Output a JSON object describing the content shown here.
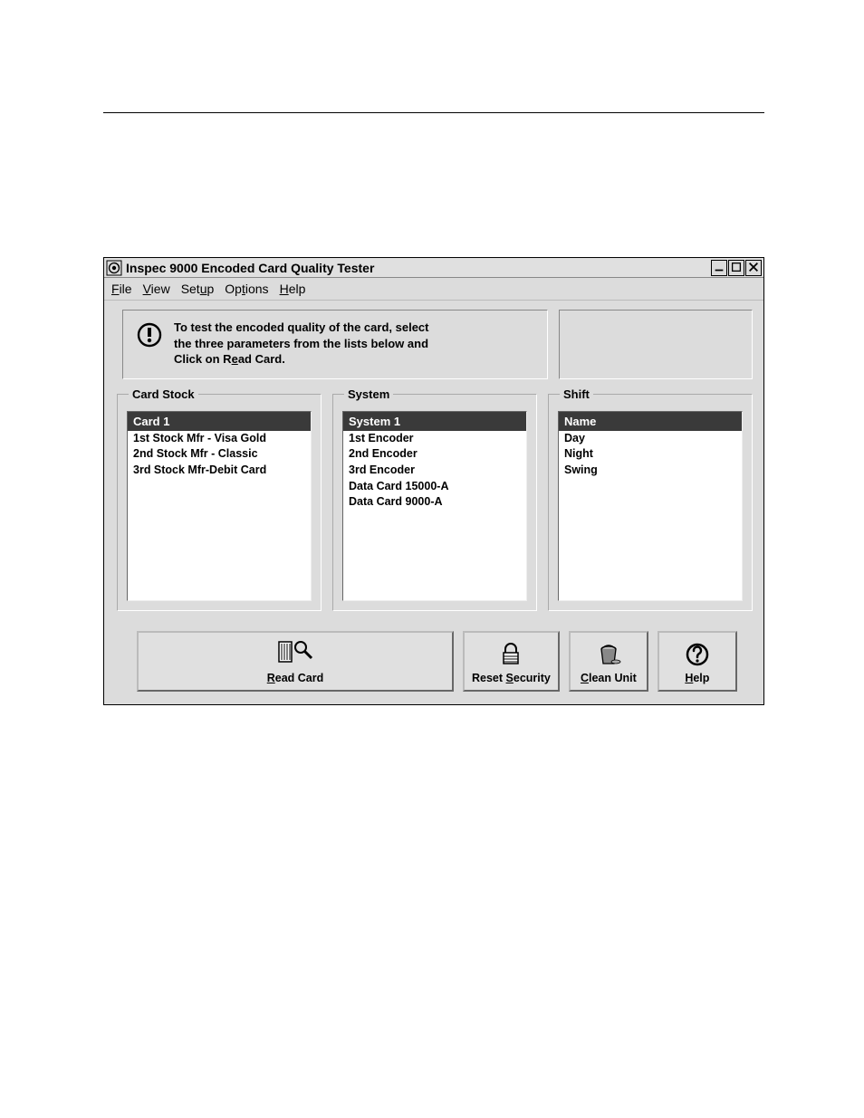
{
  "window": {
    "title": "Inspec 9000 Encoded Card Quality Tester"
  },
  "menu": {
    "file": "File",
    "view": "View",
    "setup": "Setup",
    "options": "Options",
    "help": "Help"
  },
  "info": {
    "line1": "To test the encoded quality of the card, select",
    "line2": "the three parameters from the lists below and",
    "line3_pre": "Click on R",
    "line3_post": "ead Card."
  },
  "groups": {
    "card_stock": {
      "label": "Card Stock",
      "header": "Card 1",
      "items": [
        "1st Stock Mfr - Visa Gold",
        "2nd Stock Mfr - Classic",
        "3rd Stock Mfr-Debit Card"
      ]
    },
    "system": {
      "label": "System",
      "header": "System 1",
      "items": [
        "1st Encoder",
        "2nd Encoder",
        "3rd Encoder",
        "Data Card 15000-A",
        "Data Card 9000-A"
      ]
    },
    "shift": {
      "label": "Shift",
      "header": "Name",
      "items": [
        "Day",
        "Night",
        "Swing"
      ]
    }
  },
  "buttons": {
    "read_card_pre": "R",
    "read_card_post": "ead Card",
    "reset_security_pre": "Reset ",
    "reset_security_mid": "S",
    "reset_security_post": "ecurity",
    "clean_unit_pre": "C",
    "clean_unit_post": "lean Unit",
    "help_pre": "H",
    "help_post": "elp"
  }
}
